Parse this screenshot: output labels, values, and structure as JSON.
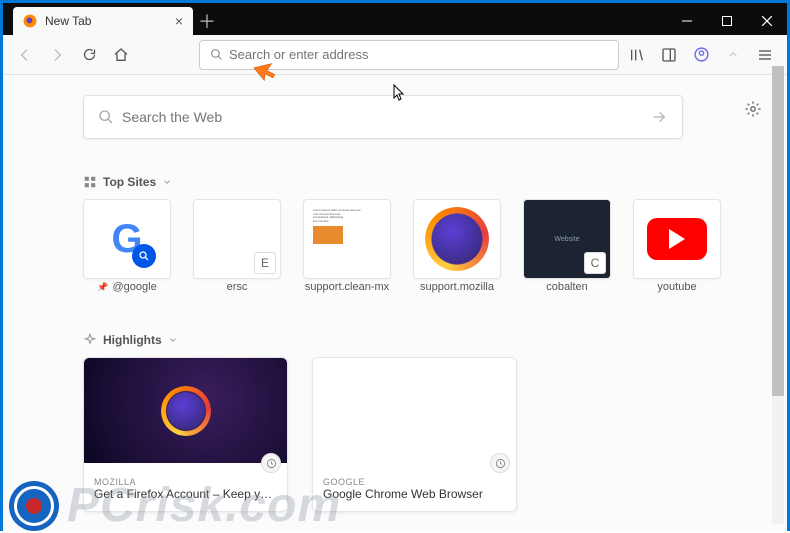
{
  "tab": {
    "title": "New Tab"
  },
  "urlbar": {
    "placeholder": "Search or enter address"
  },
  "websearch": {
    "placeholder": "Search the Web"
  },
  "sections": {
    "top_sites": {
      "heading": "Top Sites"
    },
    "highlights": {
      "heading": "Highlights"
    }
  },
  "topsites": [
    {
      "label": "@google",
      "pinned": true,
      "badge": ""
    },
    {
      "label": "ersc",
      "pinned": false,
      "badge": "E"
    },
    {
      "label": "support.clean-mx",
      "pinned": false,
      "badge": ""
    },
    {
      "label": "support.mozilla",
      "pinned": false,
      "badge": ""
    },
    {
      "label": "cobalten",
      "pinned": false,
      "badge": "C"
    },
    {
      "label": "youtube",
      "pinned": false,
      "badge": ""
    }
  ],
  "highlights": [
    {
      "source": "MOZILLA",
      "title": "Get a Firefox Account – Keep you…"
    },
    {
      "source": "GOOGLE",
      "title": "Google Chrome Web Browser"
    }
  ],
  "watermark": {
    "text": "PCrisk.com"
  }
}
